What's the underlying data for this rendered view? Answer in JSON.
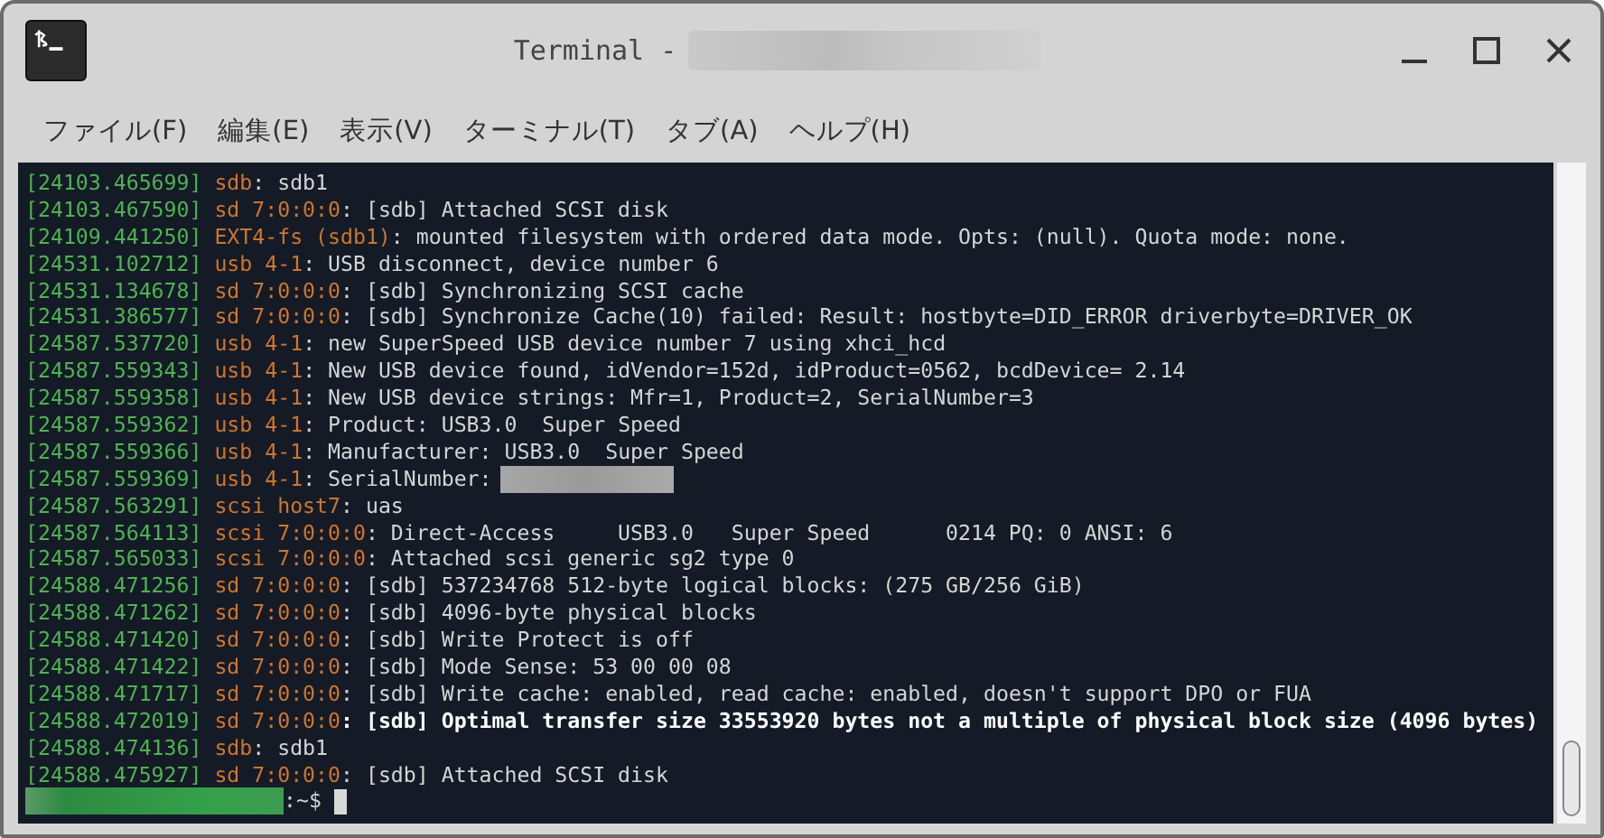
{
  "window": {
    "title": "Terminal -"
  },
  "menu": [
    "ファイル(F)",
    "編集(E)",
    "表示(V)",
    "ターミナル(T)",
    "タブ(A)",
    "ヘルプ(H)"
  ],
  "lines": [
    {
      "time": "[24103.465699]",
      "source": "sdb",
      "message": ": sdb1",
      "bold": false
    },
    {
      "time": "[24103.467590]",
      "source": "sd 7:0:0:0",
      "message": ": [sdb] Attached SCSI disk",
      "bold": false
    },
    {
      "time": "[24109.441250]",
      "source": "EXT4-fs (sdb1)",
      "message": ": mounted filesystem with ordered data mode. Opts: (null). Quota mode: none.",
      "bold": false
    },
    {
      "time": "[24531.102712]",
      "source": "usb 4-1",
      "message": ": USB disconnect, device number 6",
      "bold": false
    },
    {
      "time": "[24531.134678]",
      "source": "sd 7:0:0:0",
      "message": ": [sdb] Synchronizing SCSI cache",
      "bold": false
    },
    {
      "time": "[24531.386577]",
      "source": "sd 7:0:0:0",
      "message": ": [sdb] Synchronize Cache(10) failed: Result: hostbyte=DID_ERROR driverbyte=DRIVER_OK",
      "bold": false
    },
    {
      "time": "[24587.537720]",
      "source": "usb 4-1",
      "message": ": new SuperSpeed USB device number 7 using xhci_hcd",
      "bold": false
    },
    {
      "time": "[24587.559343]",
      "source": "usb 4-1",
      "message": ": New USB device found, idVendor=152d, idProduct=0562, bcdDevice= 2.14",
      "bold": false
    },
    {
      "time": "[24587.559358]",
      "source": "usb 4-1",
      "message": ": New USB device strings: Mfr=1, Product=2, SerialNumber=3",
      "bold": false
    },
    {
      "time": "[24587.559362]",
      "source": "usb 4-1",
      "message": ": Product: USB3.0  Super Speed",
      "bold": false
    },
    {
      "time": "[24587.559366]",
      "source": "usb 4-1",
      "message": ": Manufacturer: USB3.0  Super Speed",
      "bold": false
    },
    {
      "time": "[24587.559369]",
      "source": "usb 4-1",
      "message": ": SerialNumber:",
      "bold": false,
      "redacted": true
    },
    {
      "time": "[24587.563291]",
      "source": "scsi host7",
      "message": ": uas",
      "bold": false
    },
    {
      "time": "[24587.564113]",
      "source": "scsi 7:0:0:0",
      "message": ": Direct-Access     USB3.0   Super Speed      0214 PQ: 0 ANSI: 6",
      "bold": false
    },
    {
      "time": "[24587.565033]",
      "source": "scsi 7:0:0:0",
      "message": ": Attached scsi generic sg2 type 0",
      "bold": false
    },
    {
      "time": "[24588.471256]",
      "source": "sd 7:0:0:0",
      "message": ": [sdb] 537234768 512-byte logical blocks: (275 GB/256 GiB)",
      "bold": false
    },
    {
      "time": "[24588.471262]",
      "source": "sd 7:0:0:0",
      "message": ": [sdb] 4096-byte physical blocks",
      "bold": false
    },
    {
      "time": "[24588.471420]",
      "source": "sd 7:0:0:0",
      "message": ": [sdb] Write Protect is off",
      "bold": false
    },
    {
      "time": "[24588.471422]",
      "source": "sd 7:0:0:0",
      "message": ": [sdb] Mode Sense: 53 00 00 08",
      "bold": false
    },
    {
      "time": "[24588.471717]",
      "source": "sd 7:0:0:0",
      "message": ": [sdb] Write cache: enabled, read cache: enabled, doesn't support DPO or FUA",
      "bold": false
    },
    {
      "time": "[24588.472019]",
      "source": "sd 7:0:0:0",
      "message": ": [sdb] Optimal transfer size 33553920 bytes not a multiple of physical block size (4096 bytes)",
      "bold": true
    },
    {
      "time": "[24588.474136]",
      "source": "sdb",
      "message": ": sdb1",
      "bold": false
    },
    {
      "time": "[24588.475927]",
      "source": "sd 7:0:0:0",
      "message": ": [sdb] Attached SCSI disk",
      "bold": false
    }
  ],
  "prompt": {
    "text": ":~$"
  }
}
